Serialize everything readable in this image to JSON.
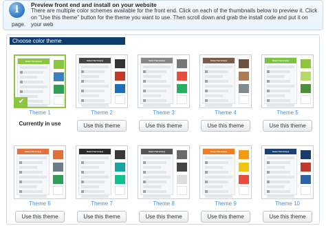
{
  "info": {
    "icon": "info-icon",
    "title": "Preview front end and install on your website",
    "body": "There are multiple color schemes available for the front end. Click on each of the thumbnails below to preview it. Click on \"Use this theme\" button for the theme you want to use. Then scroll down and grab the install code and put it on your web",
    "body_tail": "page."
  },
  "panel": {
    "header": "Choose color theme"
  },
  "themes": [
    {
      "name": "Theme 1",
      "action": "Currently in use",
      "selected": true,
      "header_color": "#8cc63f",
      "swatches": [
        "#8cc63f",
        "#3f7fbf",
        "#2e9e59",
        "#ffffff"
      ],
      "form_header": "Select Service(s)"
    },
    {
      "name": "Theme 2",
      "action": "Use this theme",
      "header_color": "#444444",
      "swatches": [
        "#333333",
        "#c0392b",
        "#1e6fb8",
        "#ffffff"
      ],
      "form_header": "Select Service(s)"
    },
    {
      "name": "Theme 3",
      "action": "Use this theme",
      "header_color": "#888888",
      "swatches": [
        "#777777",
        "#e74c3c",
        "#27ae60",
        "#ffffff"
      ],
      "form_header": "Select Service(s)"
    },
    {
      "name": "Theme 4",
      "action": "Use this theme",
      "header_color": "#7a5c48",
      "swatches": [
        "#6e5342",
        "#b07a52",
        "#7f8c8d",
        "#ffffff"
      ],
      "form_header": "Select Service(s)"
    },
    {
      "name": "Theme 5",
      "action": "Use this theme",
      "header_color": "#7dc242",
      "swatches": [
        "#8cc63f",
        "#b5d96b",
        "#4c8f3a",
        "#ffffff"
      ],
      "form_header": "Select Service(s)"
    },
    {
      "name": "Theme 6",
      "action": "Use this theme",
      "header_color": "#e0743c",
      "swatches": [
        "#e26f36",
        "#6f7c87",
        "#2e9e59",
        "#ffffff"
      ],
      "form_header": "Select Service(s)"
    },
    {
      "name": "Theme 7",
      "action": "Use this theme",
      "header_color": "#2b2b2b",
      "swatches": [
        "#3a3a3a",
        "#16a5a0",
        "#11c08f",
        "#ffffff"
      ],
      "form_header": "Select Service(s)"
    },
    {
      "name": "Theme 8",
      "action": "Use this theme",
      "header_color": "#555555",
      "swatches": [
        "#6b6b6b",
        "#444444",
        "#dddddd",
        "#ffffff"
      ],
      "form_header": "Select Service(s)"
    },
    {
      "name": "Theme 9",
      "action": "Use this theme",
      "header_color": "#ef7d22",
      "swatches": [
        "#f39c12",
        "#f1c40f",
        "#e74c3c",
        "#ffffff"
      ],
      "form_header": "Select Service(s)"
    },
    {
      "name": "Theme 10",
      "action": "Use this theme",
      "header_color": "#1d3f72",
      "swatches": [
        "#1a3b6d",
        "#c0392b",
        "#2c62a8",
        "#ffffff"
      ],
      "form_header": "Select Service(s)"
    }
  ]
}
